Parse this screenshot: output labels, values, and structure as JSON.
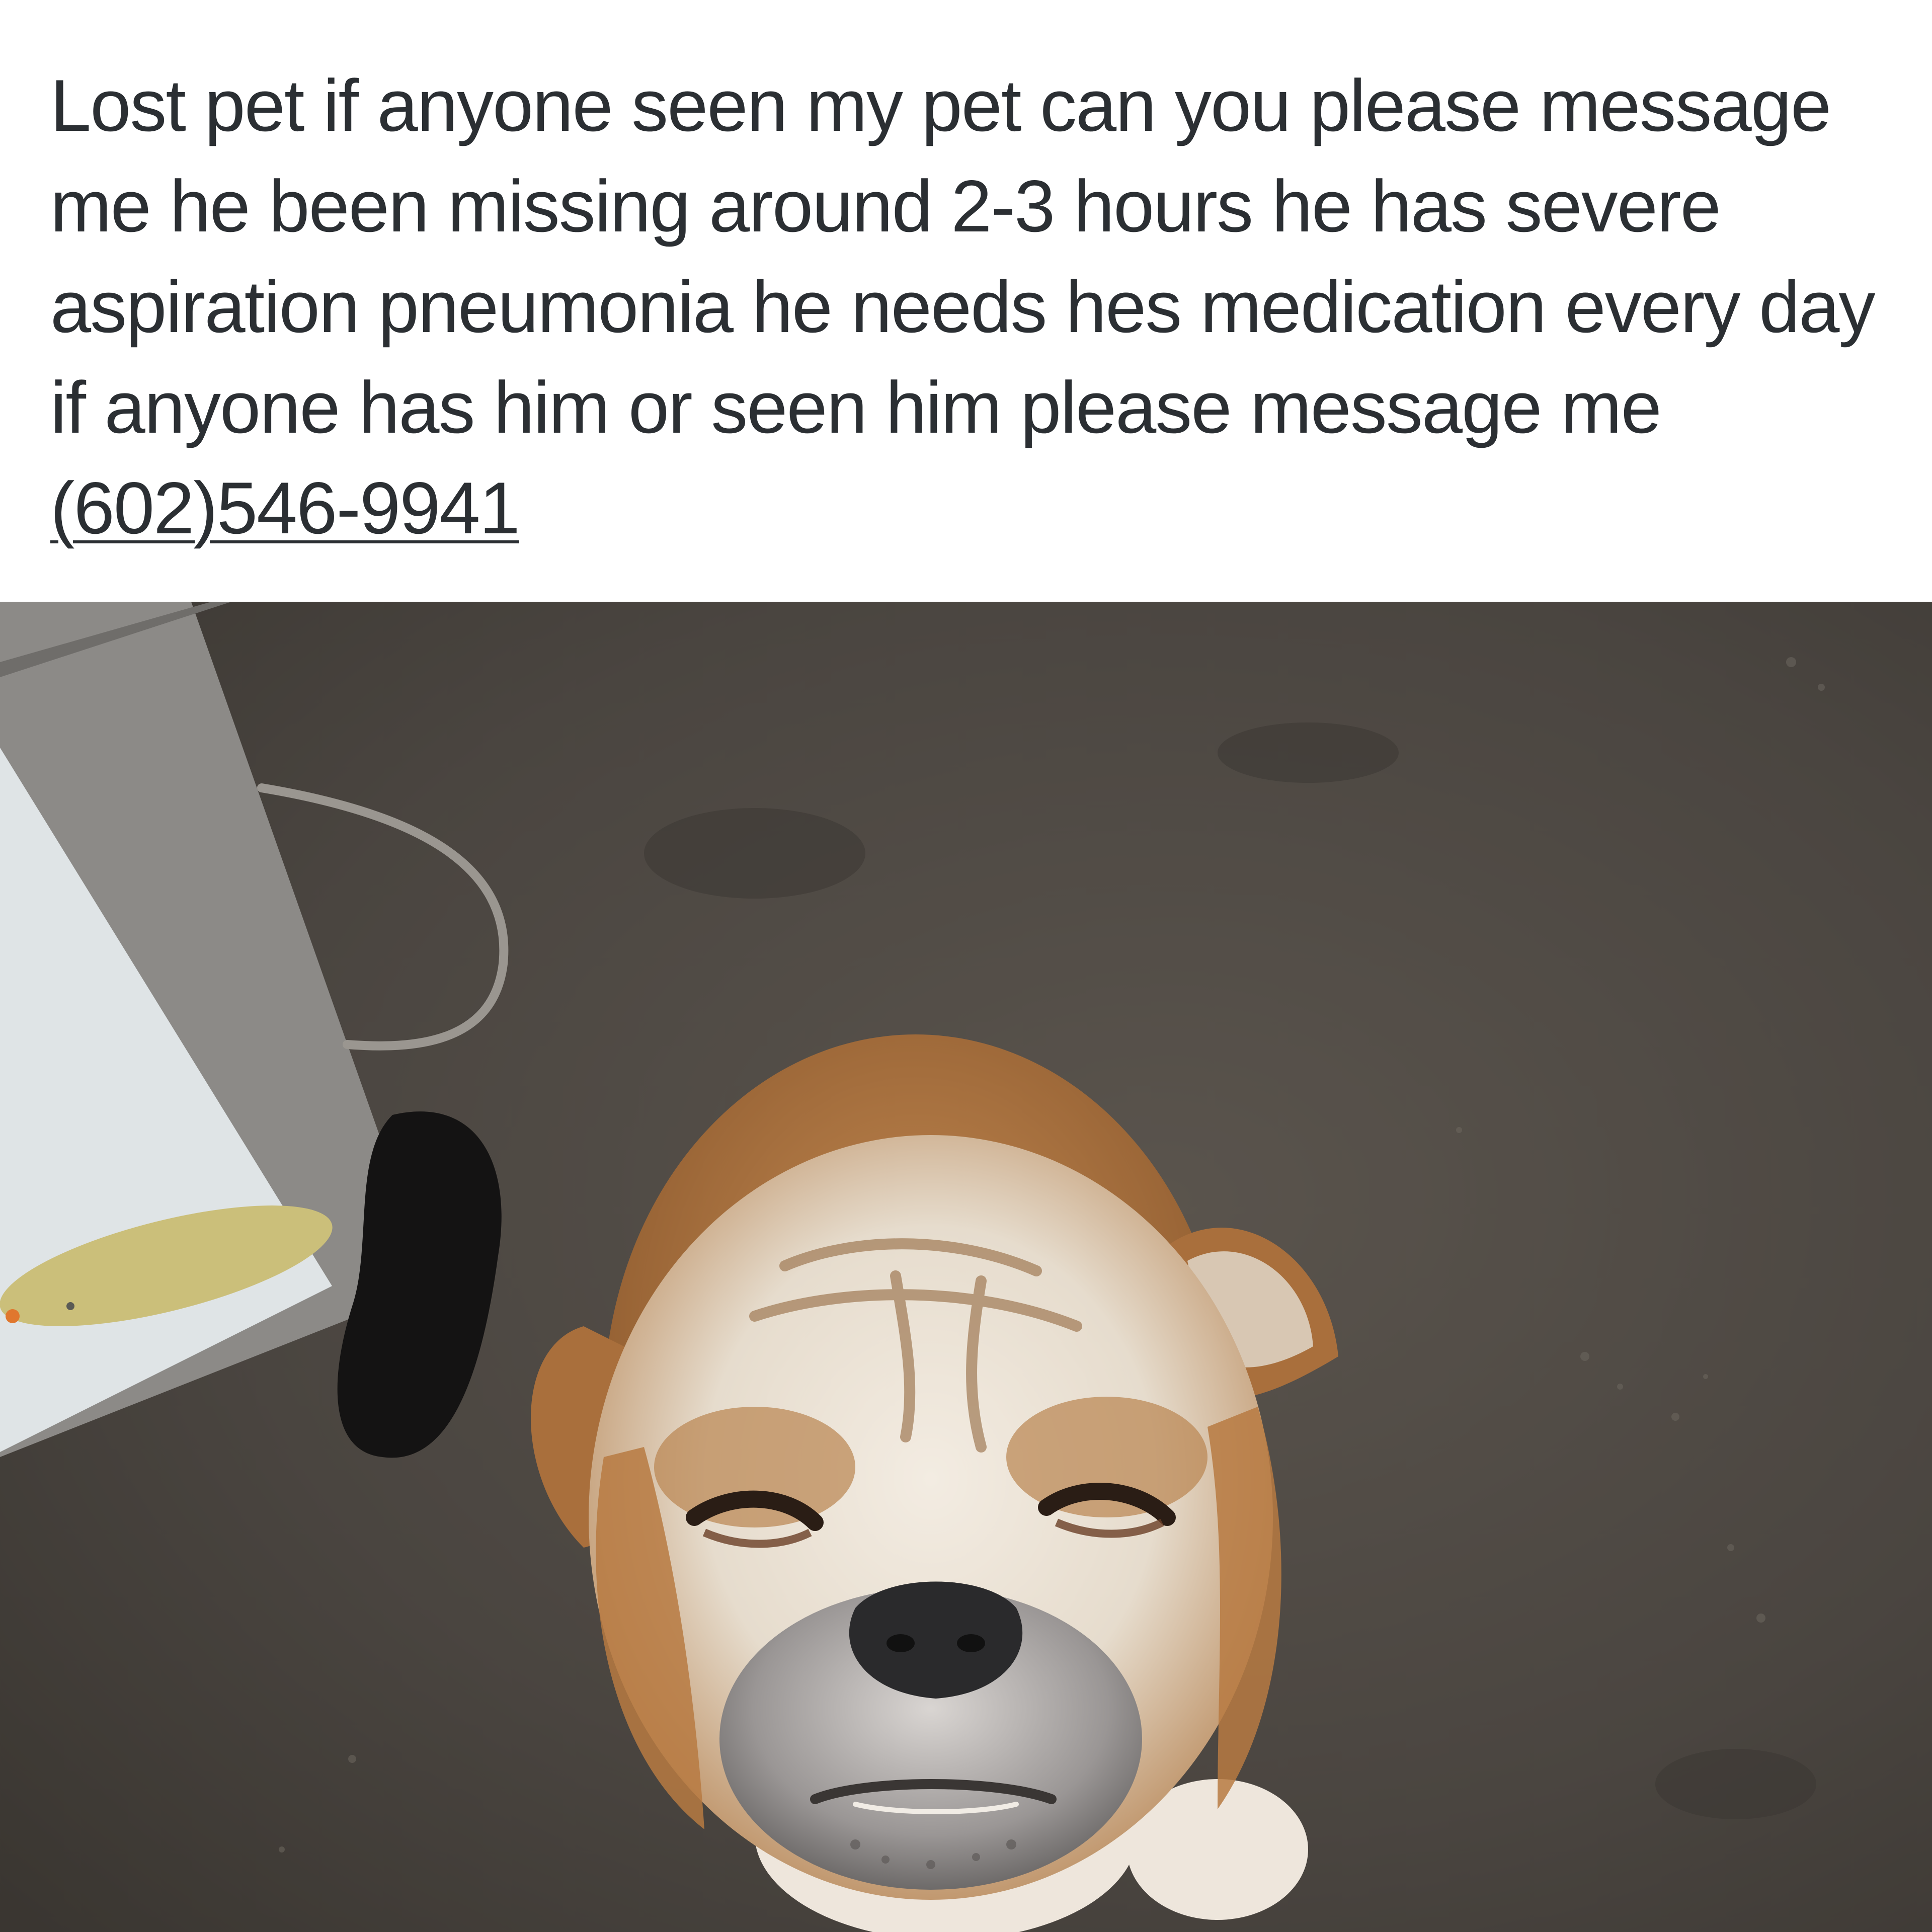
{
  "post": {
    "text_before_phone": "Lost pet if anyone seen my pet can you please message me he been missing around 2-3 hours he has severe aspiration pneumonia he needs hes medication every day if anyone has him or seen him please message me ",
    "phone": "(602)546-9941"
  },
  "photo": {
    "subject": "bulldog-photo",
    "colors": {
      "floor": "#4d4842",
      "box_front": "#dfe4e6",
      "box_side": "#8f8d8a",
      "fur_tan": "#b07a45",
      "fur_white": "#efe7dc",
      "nose": "#2a2a2c"
    }
  }
}
